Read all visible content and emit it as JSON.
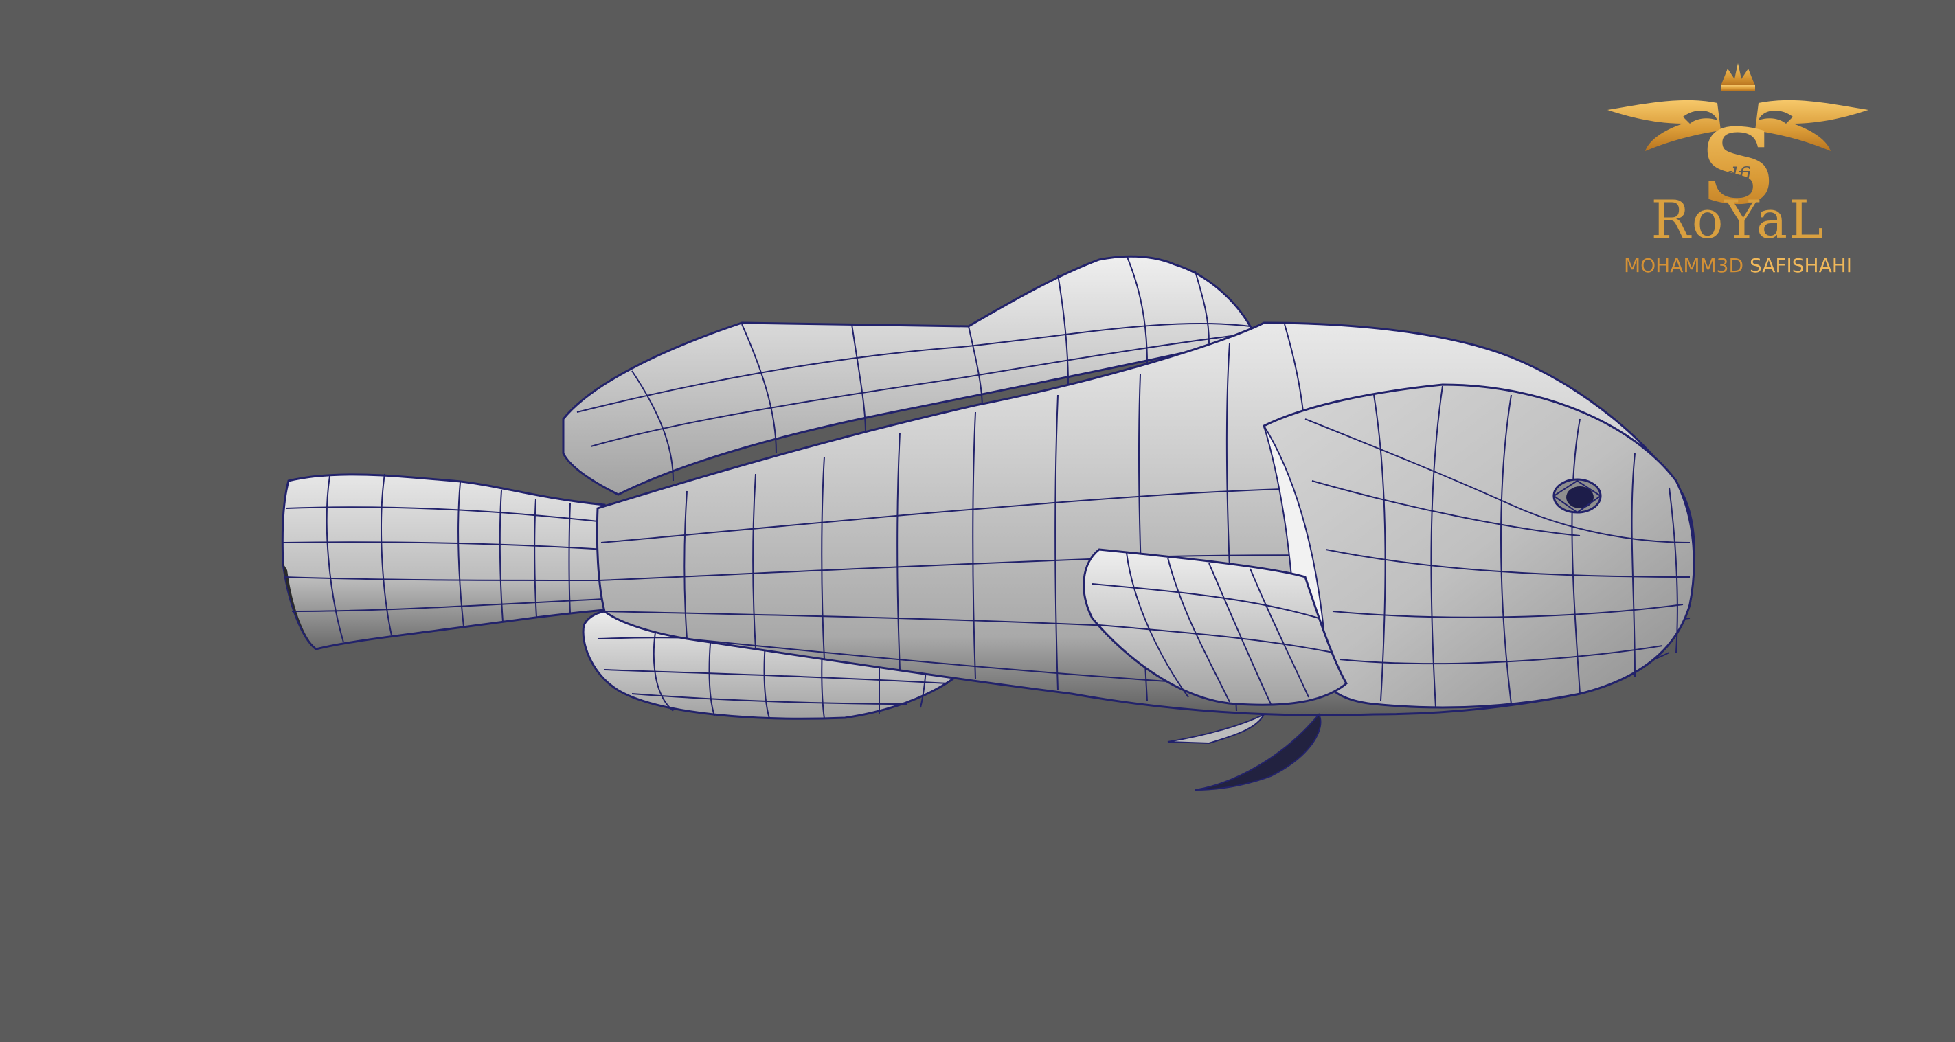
{
  "scene": {
    "background": "#5b5b5b",
    "subject": "fish-model",
    "mesh_fill": "#c2c2c2",
    "wire_color": "#22226b"
  },
  "watermark": {
    "emblem_letter": "S",
    "emblem_monogram": "dfi",
    "title": "RoYaL",
    "subtitle_first": "MOHAMM3D",
    "subtitle_second": "SAFISHAHI",
    "gold": "#d9a040"
  }
}
